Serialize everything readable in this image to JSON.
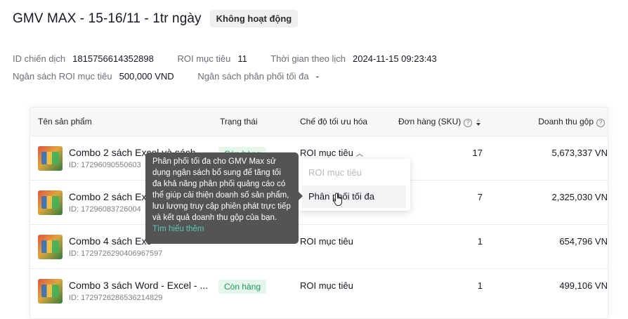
{
  "campaign": {
    "title": "GMV MAX - 15-16/11 - 1tr ngày",
    "status_badge": "Không hoạt động",
    "id_label": "ID chiến dịch",
    "id_value": "1815756614352898",
    "roi_label": "ROI mục tiêu",
    "roi_value": "11",
    "schedule_label": "Thời gian theo lịch",
    "schedule_value": "2024-11-15 09:23:43",
    "budget_label": "Ngân sách ROI mục tiêu",
    "budget_value": "500,000 VND",
    "maxdist_label": "Ngân sách phân phối tối đa",
    "maxdist_value": "-"
  },
  "table": {
    "headers": {
      "product": "Tên sản phẩm",
      "status": "Trạng thái",
      "mode": "Chế độ tối ưu hóa",
      "orders": "Đơn hàng (SKU)",
      "revenue": "Doanh thu gộp"
    },
    "rows": [
      {
        "name": "Combo 2 sách Excel và sách",
        "id": "ID: 17296090550603",
        "status": "Còn hàng",
        "mode": "ROI mục tiêu",
        "orders": "17",
        "revenue": "5,673,337 VN"
      },
      {
        "name": "Combo 2 sách Exc",
        "id": "ID: 17296083726004",
        "status": "",
        "mode": "",
        "orders": "7",
        "revenue": "2,325,030 VN"
      },
      {
        "name": "Combo 4 sách Exc",
        "id": "ID: 1729726290406967597",
        "status": "",
        "mode": "ROI mục tiêu",
        "orders": "1",
        "revenue": "654,796 VN"
      },
      {
        "name": "Combo 3 sách Word - Excel - ...",
        "id": "ID: 1729726286536214829",
        "status": "Còn hàng",
        "mode": "ROI mục tiêu",
        "orders": "1",
        "revenue": "499,106 VN"
      }
    ]
  },
  "dropdown": {
    "options": [
      "ROI mục tiêu",
      "Phân phối tối đa"
    ]
  },
  "tooltip": {
    "text": "Phân phối tối đa cho GMV Max sử dụng ngân sách bổ sung để tăng tối đa khả năng phân phối quảng cáo có thể giúp cải thiện doanh số sản phẩm, lưu lượng truy cập phiên phát trực tiếp và kết quả doanh thu gộp của bạn.",
    "link": "Tìm hiểu thêm"
  },
  "colors": {
    "instock_green": "#1a9c56",
    "tooltip_bg": "#545454",
    "link_teal": "#59c9b6"
  }
}
